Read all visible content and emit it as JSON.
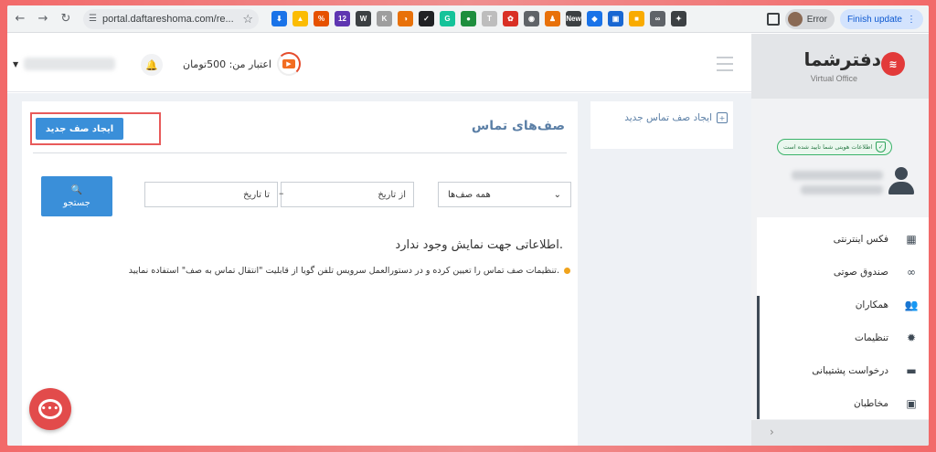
{
  "browser": {
    "url": "portal.daftareshoma.com/re...",
    "error_label": "Error",
    "update_label": "Finish update",
    "extensions": [
      {
        "name": "download-ext-icon",
        "color": "#1a73e8",
        "glyph": "⬇"
      },
      {
        "name": "drive-ext-icon",
        "color": "#fbbc04",
        "glyph": "▲"
      },
      {
        "name": "vpn-ext-icon",
        "color": "#e65100",
        "glyph": "%"
      },
      {
        "name": "badge-ext-icon",
        "color": "#5e35b1",
        "glyph": "12"
      },
      {
        "name": "w-ext-icon",
        "color": "#3c4043",
        "glyph": "W"
      },
      {
        "name": "k-ext-icon",
        "color": "#9e9e9e",
        "glyph": "K"
      },
      {
        "name": "half-circle-ext-icon",
        "color": "#e8710a",
        "glyph": "◑"
      },
      {
        "name": "check-ext-icon",
        "color": "#202124",
        "glyph": "✓"
      },
      {
        "name": "grammarly-ext-icon",
        "color": "#15c39a",
        "glyph": "G"
      },
      {
        "name": "dot-ext-icon",
        "color": "#1e8e3e",
        "glyph": "●"
      },
      {
        "name": "text-ext-icon",
        "color": "#bdbdbd",
        "glyph": "T"
      },
      {
        "name": "color-wheel-ext-icon",
        "color": "#d93025",
        "glyph": "✿"
      },
      {
        "name": "camera-ext-icon",
        "color": "#5f6368",
        "glyph": "◉"
      },
      {
        "name": "figure-ext-icon",
        "color": "#e8710a",
        "glyph": "♟"
      },
      {
        "name": "new-ext-icon",
        "color": "#3c4043",
        "glyph": "New"
      },
      {
        "name": "tag-ext-icon",
        "color": "#1a73e8",
        "glyph": "◆"
      },
      {
        "name": "window-ext-icon",
        "color": "#1967d2",
        "glyph": "▣"
      },
      {
        "name": "square-ext-icon",
        "color": "#f9ab00",
        "glyph": "■"
      },
      {
        "name": "link-ext-icon",
        "color": "#5f6368",
        "glyph": "∞"
      },
      {
        "name": "puzzle-ext-icon",
        "color": "#3c4043",
        "glyph": "✦"
      }
    ]
  },
  "header": {
    "credit_text": "اعتبار من: 500تومان"
  },
  "logo": {
    "title": "دفترشما",
    "subtitle": "Virtual Office"
  },
  "sidebar": {
    "verified_text": "اطلاعات هویتی شما تایید شده است",
    "items": [
      {
        "label": "فکس اینترنتی",
        "icon": "fax-icon",
        "glyph": "▦"
      },
      {
        "label": "صندوق صوتی",
        "icon": "voicemail-icon",
        "glyph": "∞"
      },
      {
        "label": "همکاران",
        "icon": "colleagues-icon",
        "glyph": "👥"
      },
      {
        "label": "تنظیمات",
        "icon": "settings-icon",
        "glyph": "✹"
      },
      {
        "label": "درخواست پشتیبانی",
        "icon": "ticket-icon",
        "glyph": "▬"
      },
      {
        "label": "مخاطبان",
        "icon": "contacts-icon",
        "glyph": "▣"
      }
    ]
  },
  "side_panel": {
    "create_link": "ایجاد صف تماس جدید"
  },
  "main": {
    "title": "صف‌های تماس",
    "create_button": "ایجاد صف جدید",
    "queue_select": "همه صف‌ها",
    "from_date_placeholder": "از تاریخ",
    "to_date_placeholder": "تا تاریخ",
    "date_separator": "–",
    "search_button": "جستجو",
    "no_data": "اطلاعاتی جهت نمایش وجود ندارد.",
    "hint": "تنظیمات صف تماس را تعیین کرده و در دستورالعمل سرویس تلفن گویا از قابلیت \"انتقال تماس به صف\" استفاده نمایید."
  }
}
